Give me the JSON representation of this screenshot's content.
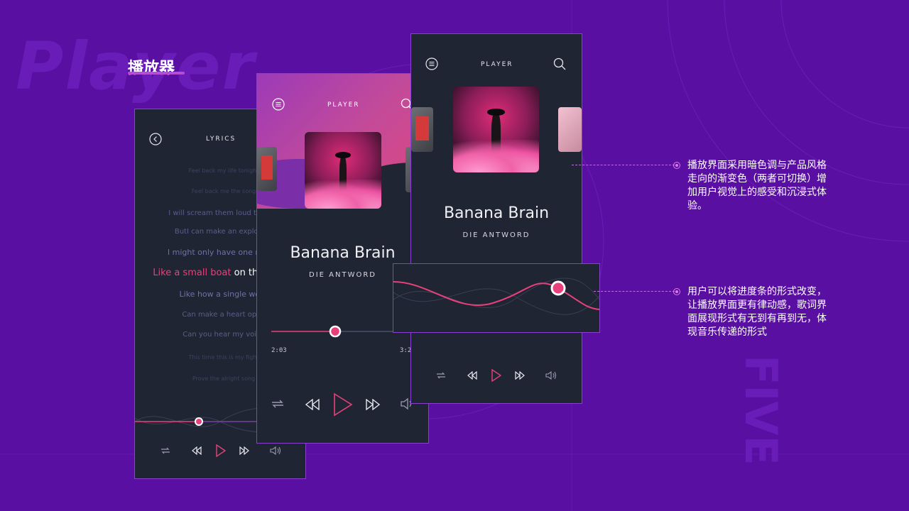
{
  "page": {
    "title": "播放器",
    "watermark": "Player",
    "side_watermark": "FIVE"
  },
  "lyrics_screen": {
    "header": "LYRICS",
    "lines": [
      "Feel back my life tonight",
      "Feel back me the song",
      "I will scream them loud tonight",
      "ButI can make an explosion",
      "I might only have one match",
      "on the ocean",
      "Like how a single word",
      "Can make a heart open",
      "Can you hear my voice",
      "This time this is my fight",
      "Prove the alright song"
    ],
    "current_highlight": "Like a small boat"
  },
  "gradient_screen": {
    "header": "PLAYER",
    "song": "Banana Brain",
    "artist": "DIE ANTWORD",
    "time_elapsed": "2:03",
    "time_total": "3:2",
    "progress": 0.5
  },
  "dark_screen": {
    "header": "PLAYER",
    "song": "Banana Brain",
    "artist": "DIE ANTWORD"
  },
  "notes": [
    "播放界面采用暗色调与产品风格走向的渐变色（两者可切换）增加用户视觉上的感受和沉浸式体验。",
    "用户可以将进度条的形式改变，让播放界面更有律动感，歌词界面展现形式有无到有再到无，体现音乐传递的形式"
  ],
  "colors": {
    "background": "#5a0fa3",
    "phone": "#1f2533",
    "accent": "#e8407a",
    "border": "#8a3fd0"
  },
  "icons": [
    "back-icon",
    "menu-icon",
    "search-icon",
    "repeat-icon",
    "rewind-icon",
    "play-icon",
    "forward-icon",
    "volume-icon"
  ]
}
